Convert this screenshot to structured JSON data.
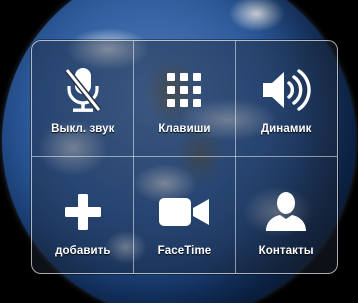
{
  "call_panel": {
    "buttons": [
      {
        "label": "Выкл. звук",
        "icon": "microphone-muted-icon"
      },
      {
        "label": "Клавиши",
        "icon": "keypad-icon"
      },
      {
        "label": "Динамик",
        "icon": "speaker-icon"
      },
      {
        "label": "добавить",
        "icon": "plus-icon"
      },
      {
        "label": "FaceTime",
        "icon": "video-camera-icon"
      },
      {
        "label": "Контакты",
        "icon": "contact-person-icon"
      }
    ]
  },
  "colors": {
    "panel_border": "#ffffff",
    "label": "#ffffff",
    "icon": "#ffffff",
    "background": "#000000"
  }
}
